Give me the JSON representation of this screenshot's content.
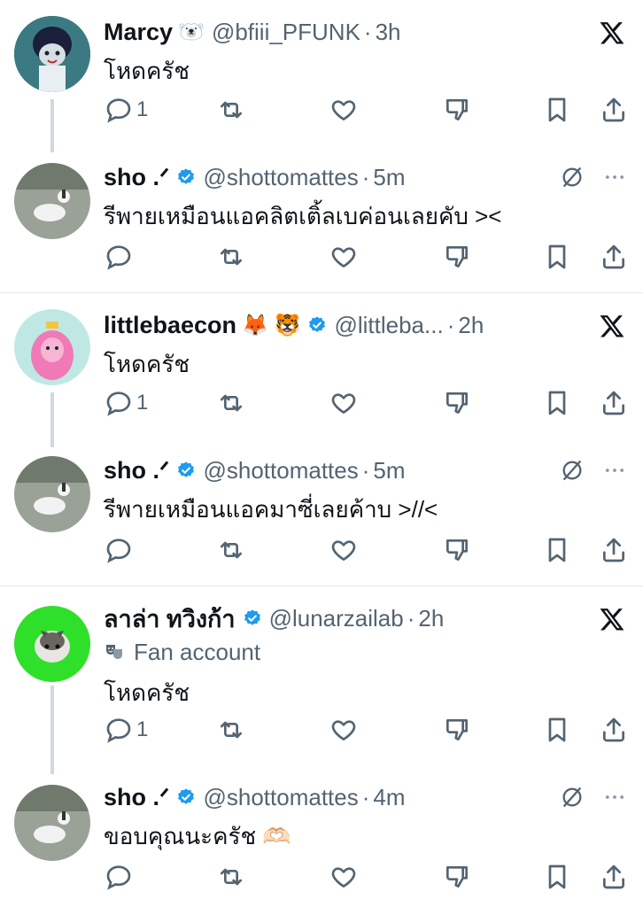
{
  "tweets": [
    {
      "name": "Marcy",
      "emoji": "🐻‍❄️",
      "handle": "@bfiii_PFUNK",
      "time": "3h",
      "text": "โหดครัช",
      "reply_count": "1",
      "verified": false,
      "top_icon": "x-logo-icon"
    },
    {
      "name": "sho .ᐟ",
      "handle": "@shottomattes",
      "time": "5m",
      "text": "รีพายเหมือนแอคลิตเติ้ลเบค่อนเลยคับ ><",
      "reply_count": "",
      "verified": true,
      "top_icon": "hide-reply-icon"
    },
    {
      "name": "littlebaecon",
      "emoji": "🦊 🐯",
      "handle": "@littleba...",
      "time": "2h",
      "text": "โหดครัช",
      "reply_count": "1",
      "verified": true,
      "top_icon": "x-logo-icon"
    },
    {
      "name": "sho .ᐟ",
      "handle": "@shottomattes",
      "time": "5m",
      "text": "รีพายเหมือนแอคมาซี่เลยค้าบ >//<",
      "reply_count": "",
      "verified": true,
      "top_icon": "hide-reply-icon"
    },
    {
      "name": "ลาล่า ทวิงก้า",
      "handle": "@lunarzailab",
      "time": "2h",
      "fan_label": "Fan account",
      "text": "โหดครัช",
      "reply_count": "1",
      "verified": true,
      "top_icon": "x-logo-icon"
    },
    {
      "name": "sho .ᐟ",
      "handle": "@shottomattes",
      "time": "4m",
      "text": "ขอบคุณนะครัช 🫶🏻",
      "reply_count": "",
      "verified": true,
      "top_icon": "hide-reply-icon"
    }
  ],
  "dot": "·",
  "colors": {
    "text": "#0f1419",
    "muted": "#536471",
    "verified": "#1d9bf0",
    "thread_line": "#cfd9de",
    "separator": "#e4e7ea"
  }
}
